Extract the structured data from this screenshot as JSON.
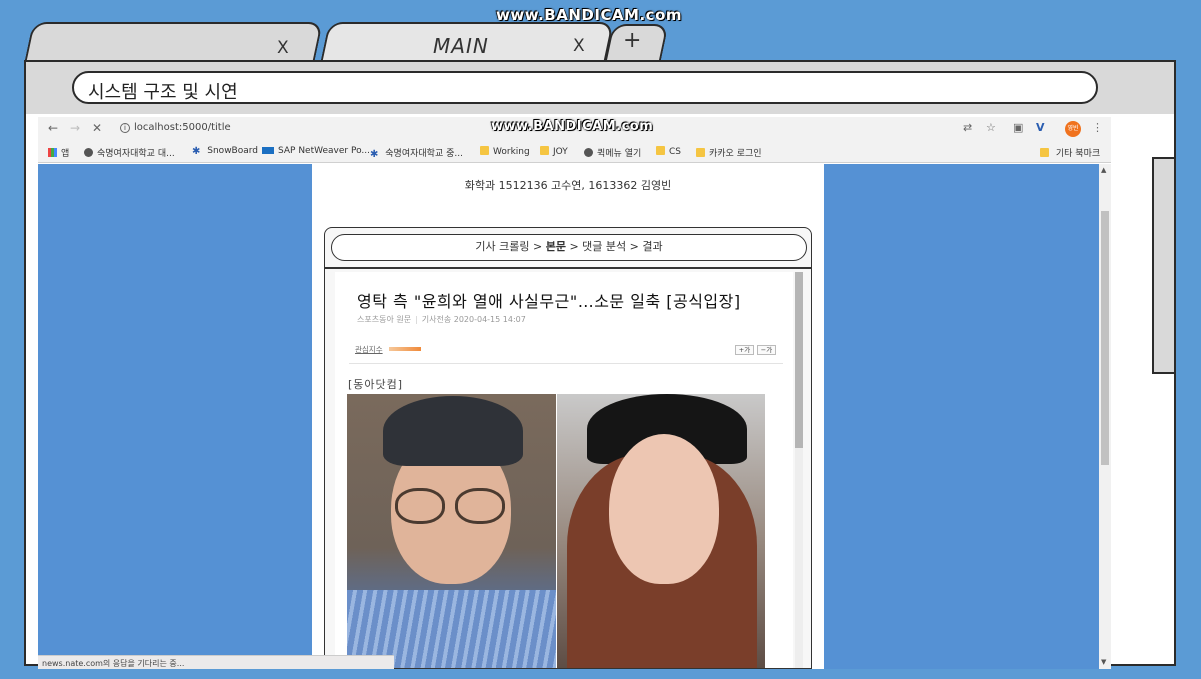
{
  "watermark": {
    "top": "www.BANDICAM.com",
    "inner": "www.BANDICAM.com"
  },
  "frame": {
    "tabs": [
      {
        "label": "",
        "close": "X"
      },
      {
        "label": "MAIN",
        "close": "X"
      }
    ],
    "new_tab": "+",
    "slide_title": "시스템 구조 및 시연"
  },
  "browser": {
    "url": "localhost:5000/title",
    "profile_label": "영빈",
    "bookmarks": [
      {
        "label": "앱",
        "icon": "apps-grid-icon"
      },
      {
        "label": "숙명여자대학교 대...",
        "icon": "globe-icon"
      },
      {
        "label": "SnowBoard",
        "icon": "star-icon"
      },
      {
        "label": "SAP NetWeaver Po...",
        "icon": "sap-icon"
      },
      {
        "label": "숙명여자대학교 중...",
        "icon": "star-icon"
      },
      {
        "label": "Working",
        "icon": "folder-icon"
      },
      {
        "label": "JOY",
        "icon": "folder-icon"
      },
      {
        "label": "퀵메뉴 열기",
        "icon": "globe-icon"
      },
      {
        "label": "CS",
        "icon": "folder-icon"
      },
      {
        "label": "카카오 로그인",
        "icon": "folder-icon"
      }
    ],
    "other_bookmarks": "기타 북마크",
    "status": "news.nate.com의 응답을 기다리는 중..."
  },
  "page": {
    "authors": "화학과 1512136 고수연, 1613362 김영빈",
    "steps": {
      "s1": "기사 크롤링 >",
      "s2": "본문",
      "s3": "> 댓글 분석 > 결과"
    },
    "article": {
      "headline": "영탁 측 \"윤희와 열애 사실무근\"…소문 일축 [공식입장]",
      "source_name": "스포츠동아 원문",
      "sent_time": "기사전송 2020-04-15 14:07",
      "interest": "관심지수",
      "font_up": "+가",
      "font_down": "−가",
      "byline": "[동아닷컴]"
    }
  }
}
